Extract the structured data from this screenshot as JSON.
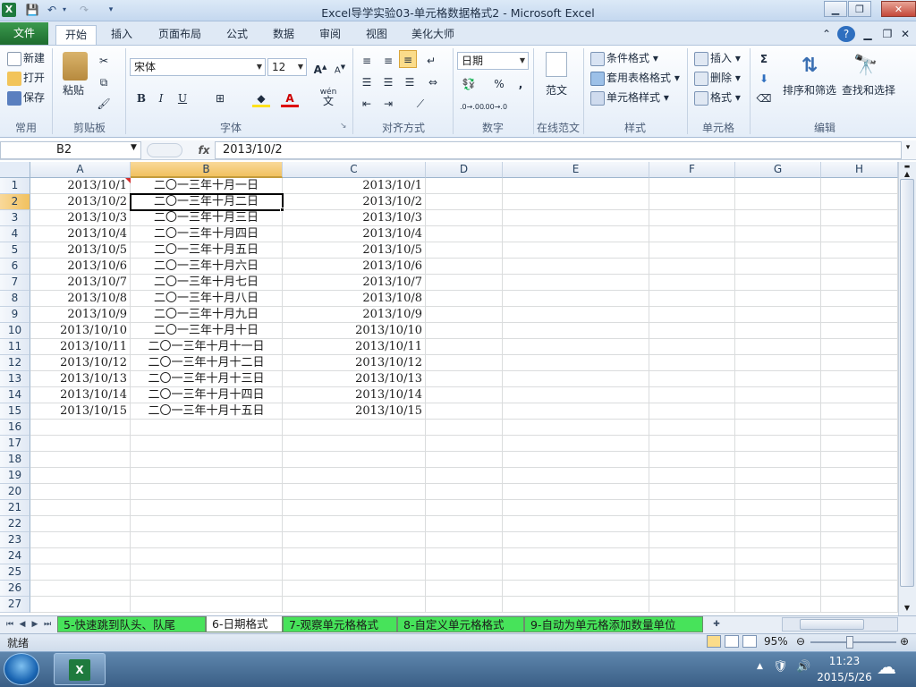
{
  "window": {
    "title": "Excel导学实验03-单元格数据格式2 - Microsoft Excel",
    "app_icon": "X"
  },
  "ribbon_tabs": [
    "文件",
    "开始",
    "插入",
    "页面布局",
    "公式",
    "数据",
    "审阅",
    "视图",
    "美化大师"
  ],
  "ribbon": {
    "common": {
      "new": "新建",
      "open": "打开",
      "save": "保存",
      "label": "常用"
    },
    "clipboard": {
      "paste": "粘贴",
      "label": "剪贴板"
    },
    "font": {
      "name": "宋体",
      "size": "12",
      "bold": "B",
      "italic": "I",
      "underline": "U",
      "fill_label": "A",
      "wen": "wén",
      "wen2": "文",
      "label": "字体"
    },
    "align": {
      "label": "对齐方式"
    },
    "number": {
      "format": "日期",
      "percent": "%",
      "comma": ",",
      "label": "数字"
    },
    "fanwen": {
      "btn": "范文",
      "label": "在线范文"
    },
    "styles": {
      "cond": "条件格式",
      "table": "套用表格格式",
      "cell": "单元格样式",
      "label": "样式"
    },
    "cells": {
      "insert": "插入",
      "delete": "删除",
      "format": "格式",
      "label": "单元格"
    },
    "editing": {
      "sigma": "Σ",
      "sort": "排序和筛选",
      "find": "查找和选择",
      "label": "编辑"
    }
  },
  "formula_bar": {
    "name_box": "B2",
    "fx": "fx",
    "content": "2013/10/2"
  },
  "columns": [
    "A",
    "B",
    "C",
    "D",
    "E",
    "F",
    "G",
    "H"
  ],
  "rows": [
    {
      "n": "1",
      "a": "2013/10/1",
      "b": "二〇一三年十月一日",
      "c": "2013/10/1"
    },
    {
      "n": "2",
      "a": "2013/10/2",
      "b": "二〇一三年十月二日",
      "c": "2013/10/2"
    },
    {
      "n": "3",
      "a": "2013/10/3",
      "b": "二〇一三年十月三日",
      "c": "2013/10/3"
    },
    {
      "n": "4",
      "a": "2013/10/4",
      "b": "二〇一三年十月四日",
      "c": "2013/10/4"
    },
    {
      "n": "5",
      "a": "2013/10/5",
      "b": "二〇一三年十月五日",
      "c": "2013/10/5"
    },
    {
      "n": "6",
      "a": "2013/10/6",
      "b": "二〇一三年十月六日",
      "c": "2013/10/6"
    },
    {
      "n": "7",
      "a": "2013/10/7",
      "b": "二〇一三年十月七日",
      "c": "2013/10/7"
    },
    {
      "n": "8",
      "a": "2013/10/8",
      "b": "二〇一三年十月八日",
      "c": "2013/10/8"
    },
    {
      "n": "9",
      "a": "2013/10/9",
      "b": "二〇一三年十月九日",
      "c": "2013/10/9"
    },
    {
      "n": "10",
      "a": "2013/10/10",
      "b": "二〇一三年十月十日",
      "c": "2013/10/10"
    },
    {
      "n": "11",
      "a": "2013/10/11",
      "b": "二〇一三年十月十一日",
      "c": "2013/10/11"
    },
    {
      "n": "12",
      "a": "2013/10/12",
      "b": "二〇一三年十月十二日",
      "c": "2013/10/12"
    },
    {
      "n": "13",
      "a": "2013/10/13",
      "b": "二〇一三年十月十三日",
      "c": "2013/10/13"
    },
    {
      "n": "14",
      "a": "2013/10/14",
      "b": "二〇一三年十月十四日",
      "c": "2013/10/14"
    },
    {
      "n": "15",
      "a": "2013/10/15",
      "b": "二〇一三年十月十五日",
      "c": "2013/10/15"
    },
    {
      "n": "16",
      "a": "",
      "b": "",
      "c": ""
    },
    {
      "n": "17",
      "a": "",
      "b": "",
      "c": ""
    },
    {
      "n": "18",
      "a": "",
      "b": "",
      "c": ""
    },
    {
      "n": "19",
      "a": "",
      "b": "",
      "c": ""
    },
    {
      "n": "20",
      "a": "",
      "b": "",
      "c": ""
    },
    {
      "n": "21",
      "a": "",
      "b": "",
      "c": ""
    },
    {
      "n": "22",
      "a": "",
      "b": "",
      "c": ""
    },
    {
      "n": "23",
      "a": "",
      "b": "",
      "c": ""
    },
    {
      "n": "24",
      "a": "",
      "b": "",
      "c": ""
    },
    {
      "n": "25",
      "a": "",
      "b": "",
      "c": ""
    },
    {
      "n": "26",
      "a": "",
      "b": "",
      "c": ""
    },
    {
      "n": "27",
      "a": "",
      "b": "",
      "c": ""
    }
  ],
  "sheet_tabs": [
    {
      "label": "5-快速跳到队头、队尾",
      "active": false
    },
    {
      "label": "6-日期格式",
      "active": true
    },
    {
      "label": "7-观察单元格格式",
      "active": false
    },
    {
      "label": "8-自定义单元格格式",
      "active": false
    },
    {
      "label": "9-自动为单元格添加数量单位",
      "active": false
    }
  ],
  "status": {
    "ready": "就绪",
    "zoom": "95%"
  },
  "taskbar": {
    "time": "11:23",
    "date": "2015/5/26"
  },
  "colors": {
    "sheet_tab_green": "#47e35a",
    "selected_header": "#f1c15f",
    "file_tab": "#1d6b2e"
  }
}
